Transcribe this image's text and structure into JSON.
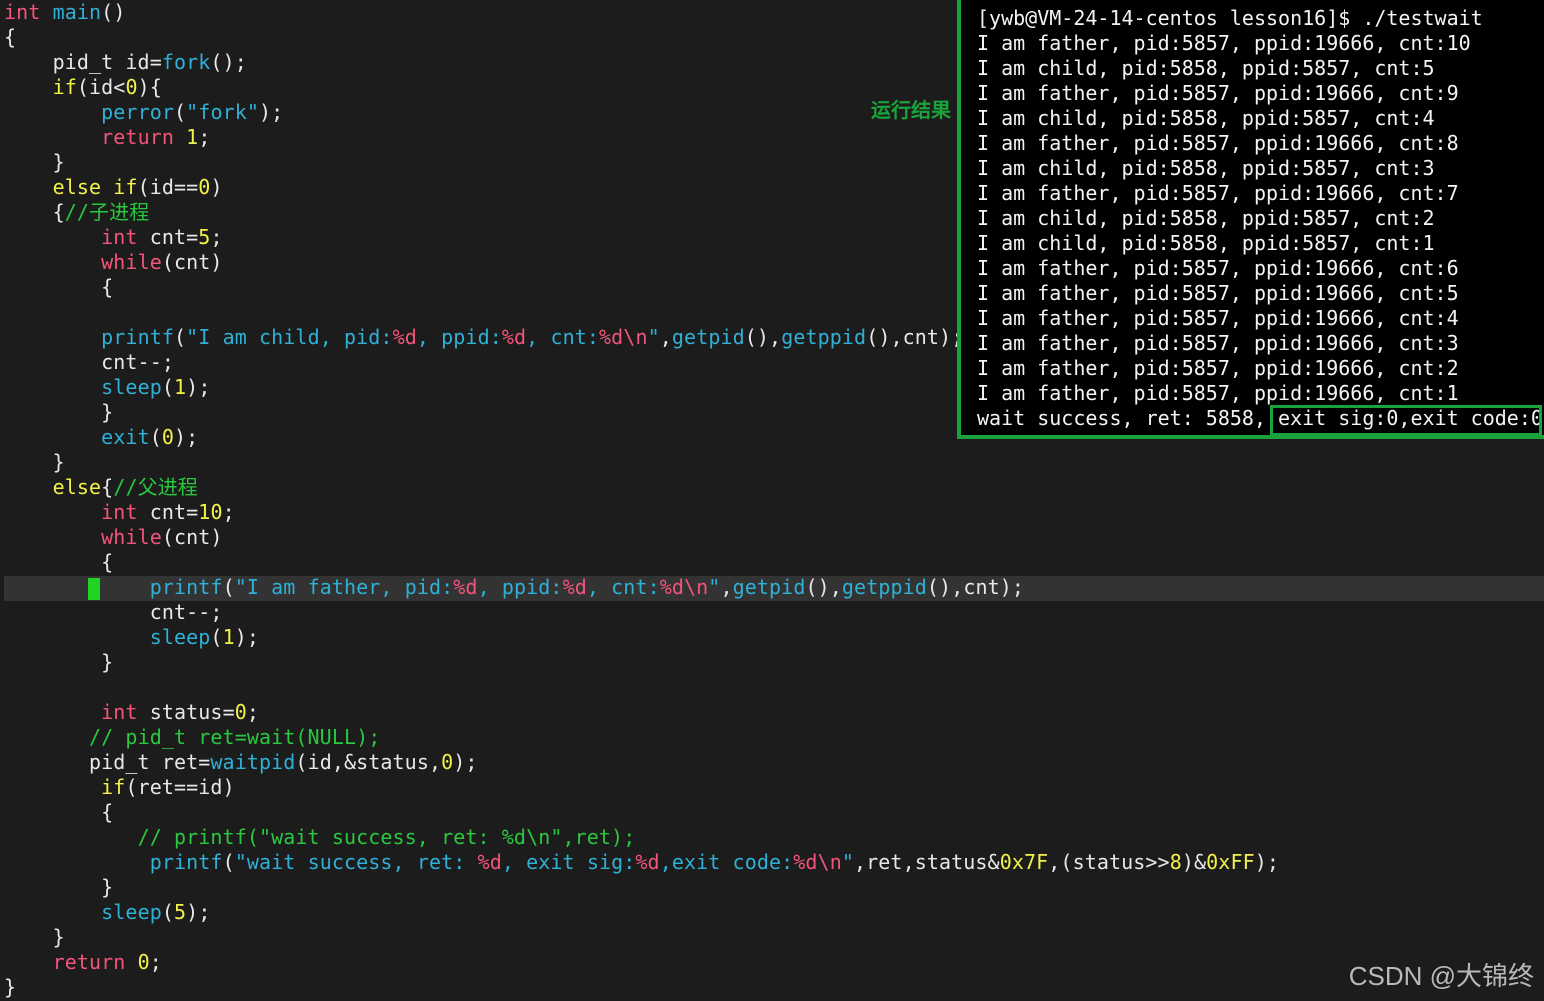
{
  "editor": {
    "code_lines": [
      "int main()",
      "{",
      "    pid_t id=fork();",
      "    if(id<0){",
      "        perror(\"fork\");",
      "        return 1;",
      "    }",
      "    else if(id==0)",
      "    {//子进程",
      "        int cnt=5;",
      "        while(cnt)",
      "        {",
      "",
      "        printf(\"I am child, pid:%d, ppid:%d, cnt:%d\\n\",getpid(),getppid(),cnt);",
      "        cnt--;",
      "        sleep(1);",
      "        }",
      "        exit(0);",
      "    }",
      "    else{//父进程",
      "        int cnt=10;",
      "        while(cnt)",
      "        {",
      "            printf(\"I am father, pid:%d, ppid:%d, cnt:%d\\n\",getpid(),getppid(),cnt);",
      "            cnt--;",
      "            sleep(1);",
      "        }",
      "",
      "        int status=0;",
      "       // pid_t ret=wait(NULL);",
      "       pid_t ret=waitpid(id,&status,0);",
      "        if(ret==id)",
      "        {",
      "           // printf(\"wait success, ret: %d\\n\",ret);",
      "            printf(\"wait success, ret: %d, exit sig:%d,exit code:%d\\n\",ret,status&0x7F,(status>>8)&0xFF);",
      "        }",
      "        sleep(5);",
      "    }",
      "    return 0;",
      "}"
    ],
    "cursor_line": 24,
    "cursor_color": "#22d422"
  },
  "terminal": {
    "lines": [
      "[ywb@VM-24-14-centos lesson16]$ ./testwait",
      "I am father, pid:5857, ppid:19666, cnt:10",
      "I am child, pid:5858, ppid:5857, cnt:5",
      "I am father, pid:5857, ppid:19666, cnt:9",
      "I am child, pid:5858, ppid:5857, cnt:4",
      "I am father, pid:5857, ppid:19666, cnt:8",
      "I am child, pid:5858, ppid:5857, cnt:3",
      "I am father, pid:5857, ppid:19666, cnt:7",
      "I am child, pid:5858, ppid:5857, cnt:2",
      "I am child, pid:5858, ppid:5857, cnt:1",
      "I am father, pid:5857, ppid:19666, cnt:6",
      "I am father, pid:5857, ppid:19666, cnt:5",
      "I am father, pid:5857, ppid:19666, cnt:4",
      "I am father, pid:5857, ppid:19666, cnt:3",
      "I am father, pid:5857, ppid:19666, cnt:2",
      "I am father, pid:5857, ppid:19666, cnt:1",
      "wait success, ret: 5858, exit sig:0,exit code:0"
    ],
    "border_color": "#1aa33a"
  },
  "annotation": {
    "run_result_label": "运行结果"
  },
  "watermark": "CSDN @大锦终"
}
